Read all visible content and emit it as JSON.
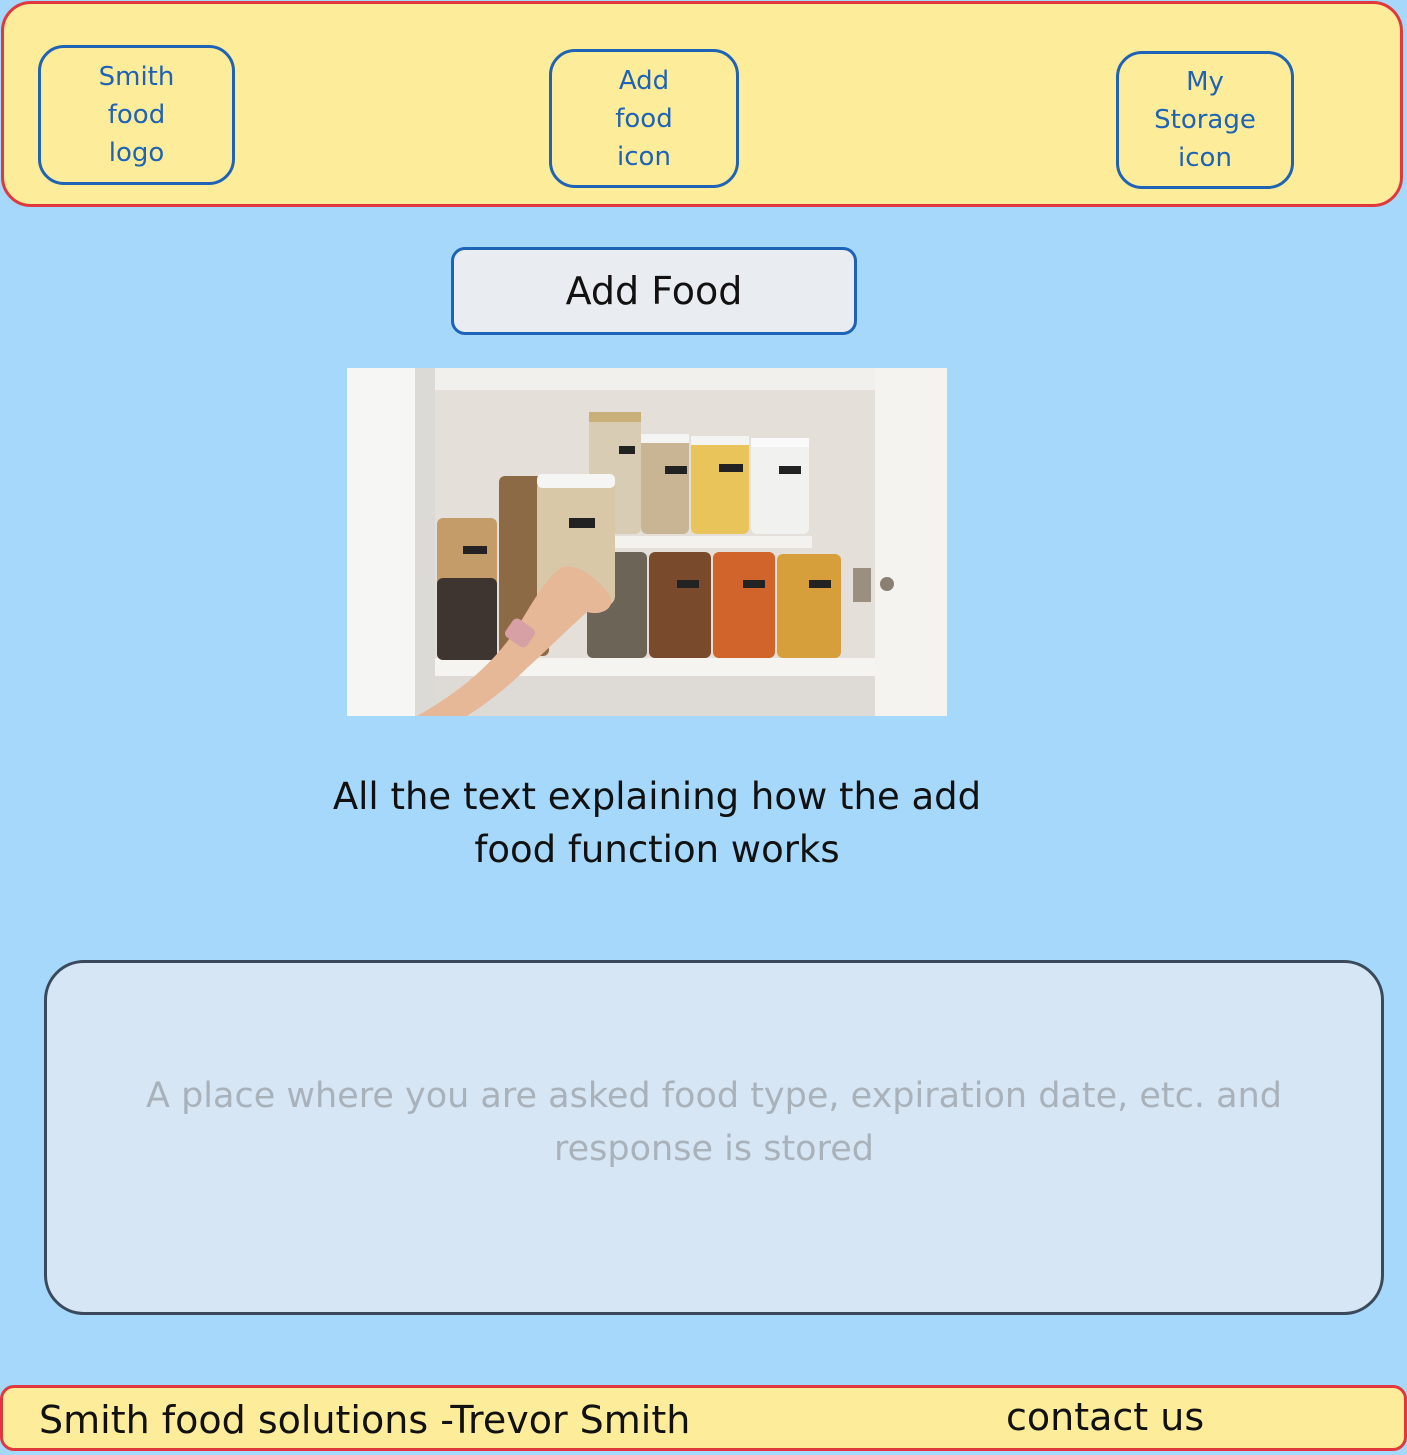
{
  "header": {
    "logo_label": "Smith\nfood\nlogo",
    "add_food_icon_label": "Add\nfood\nicon",
    "storage_icon_label": "My\nStorage\nicon"
  },
  "main": {
    "title": "Add Food",
    "image_icon": "pantry-jars-photo",
    "description": "All the text explaining how the add food function works",
    "form_placeholder": "A place where you are asked food type, expiration date, etc. and response is stored"
  },
  "footer": {
    "credit": "Smith food solutions -Trevor Smith",
    "contact_label": "contact us"
  },
  "colors": {
    "page_background": "#a5d8fb",
    "header_fill": "#fdec9a",
    "header_border": "#e0383c",
    "nav_border": "#1e63b5",
    "form_fill": "#d6e6f4"
  }
}
